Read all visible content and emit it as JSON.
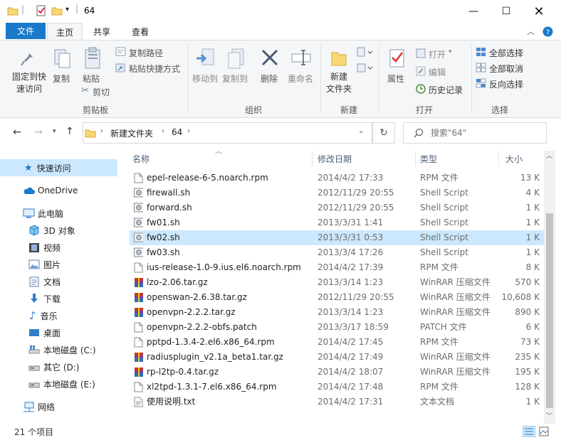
{
  "window": {
    "title": "64"
  },
  "ribbon_tabs": [
    "文件",
    "主页",
    "共享",
    "查看"
  ],
  "ribbon": {
    "clipboard": {
      "pin": "固定到快速访问",
      "pin_l1": "固定到快",
      "pin_l2": "速访问",
      "copy": "复制",
      "paste": "粘贴",
      "copy_path": "复制路径",
      "paste_shortcut": "粘贴快捷方式",
      "cut": "剪切",
      "group": "剪贴板"
    },
    "organize": {
      "move_to": "移动到",
      "copy_to": "复制到",
      "delete": "删除",
      "rename": "重命名",
      "group": "组织"
    },
    "new": {
      "new_folder_l1": "新建",
      "new_folder_l2": "文件夹",
      "group": "新建"
    },
    "open": {
      "properties": "属性",
      "open": "打开",
      "edit": "编辑",
      "history": "历史记录",
      "group": "打开"
    },
    "select": {
      "select_all": "全部选择",
      "select_none": "全部取消",
      "invert": "反向选择",
      "group": "选择"
    }
  },
  "address": {
    "crumb1": "新建文件夹",
    "crumb2": "64"
  },
  "search": {
    "placeholder": "搜索\"64\""
  },
  "nav": {
    "quick_access": "快速访问",
    "onedrive": "OneDrive",
    "this_pc": "此电脑",
    "objects3d": "3D 对象",
    "videos": "视频",
    "pictures": "图片",
    "documents": "文档",
    "downloads": "下载",
    "music": "音乐",
    "desktop": "桌面",
    "drive_c": "本地磁盘 (C:)",
    "drive_d": "其它 (D:)",
    "drive_e": "本地磁盘 (E:)",
    "network": "网络"
  },
  "columns": {
    "name": "名称",
    "date": "修改日期",
    "type": "类型",
    "size": "大小"
  },
  "files": [
    {
      "name": "epel-release-6-5.noarch.rpm",
      "date": "2014/4/2 17:33",
      "type": "RPM 文件",
      "size": "13 K",
      "icon": "file-icon"
    },
    {
      "name": "firewall.sh",
      "date": "2012/11/29 20:55",
      "type": "Shell Script",
      "size": "4 K",
      "icon": "script-icon"
    },
    {
      "name": "forward.sh",
      "date": "2012/11/29 20:55",
      "type": "Shell Script",
      "size": "1 K",
      "icon": "script-icon"
    },
    {
      "name": "fw01.sh",
      "date": "2013/3/31 1:41",
      "type": "Shell Script",
      "size": "1 K",
      "icon": "script-icon"
    },
    {
      "name": "fw02.sh",
      "date": "2013/3/31 0:53",
      "type": "Shell Script",
      "size": "1 K",
      "icon": "script-icon",
      "selected": true
    },
    {
      "name": "fw03.sh",
      "date": "2013/3/4 17:26",
      "type": "Shell Script",
      "size": "1 K",
      "icon": "script-icon"
    },
    {
      "name": "ius-release-1.0-9.ius.el6.noarch.rpm",
      "date": "2014/4/2 17:39",
      "type": "RPM 文件",
      "size": "8 K",
      "icon": "file-icon"
    },
    {
      "name": "lzo-2.06.tar.gz",
      "date": "2013/3/14 1:23",
      "type": "WinRAR 压缩文件",
      "size": "570 K",
      "icon": "winrar-icon"
    },
    {
      "name": "openswan-2.6.38.tar.gz",
      "date": "2012/11/29 20:55",
      "type": "WinRAR 压缩文件",
      "size": "10,608 K",
      "icon": "winrar-icon"
    },
    {
      "name": "openvpn-2.2.2.tar.gz",
      "date": "2013/3/14 1:23",
      "type": "WinRAR 压缩文件",
      "size": "890 K",
      "icon": "winrar-icon"
    },
    {
      "name": "openvpn-2.2.2-obfs.patch",
      "date": "2013/3/17 18:59",
      "type": "PATCH 文件",
      "size": "6 K",
      "icon": "file-icon"
    },
    {
      "name": "pptpd-1.3.4-2.el6.x86_64.rpm",
      "date": "2014/4/2 17:45",
      "type": "RPM 文件",
      "size": "73 K",
      "icon": "file-icon"
    },
    {
      "name": "radiusplugin_v2.1a_beta1.tar.gz",
      "date": "2014/4/2 17:49",
      "type": "WinRAR 压缩文件",
      "size": "235 K",
      "icon": "winrar-icon"
    },
    {
      "name": "rp-l2tp-0.4.tar.gz",
      "date": "2014/4/2 18:07",
      "type": "WinRAR 压缩文件",
      "size": "195 K",
      "icon": "winrar-icon"
    },
    {
      "name": "xl2tpd-1.3.1-7.el6.x86_64.rpm",
      "date": "2014/4/2 17:48",
      "type": "RPM 文件",
      "size": "128 K",
      "icon": "file-icon"
    },
    {
      "name": "使用说明.txt",
      "date": "2014/4/2 17:31",
      "type": "文本文档",
      "size": "1 K",
      "icon": "text-file-icon"
    }
  ],
  "status": {
    "count": "21 个项目"
  },
  "colors": {
    "accent": "#1979ca",
    "selection": "#cce8ff",
    "folder": "#f8d775"
  }
}
